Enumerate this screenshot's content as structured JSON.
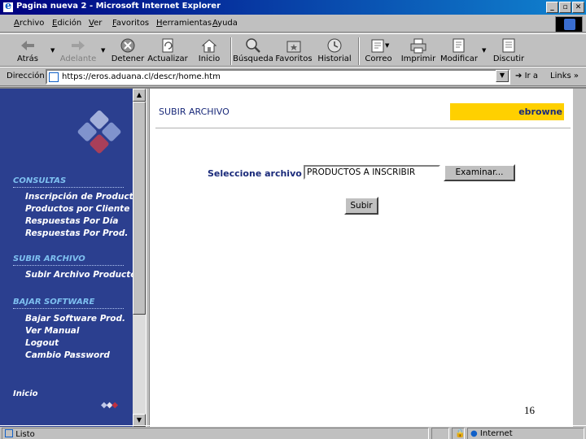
{
  "window": {
    "title": "Pagina nueva 2 - Microsoft Internet Explorer",
    "minimize": "_",
    "restore": "▫",
    "close": "✕"
  },
  "menu": [
    "Archivo",
    "Edición",
    "Ver",
    "Favoritos",
    "Herramientas",
    "Ayuda"
  ],
  "toolbar": {
    "back": "Atrás",
    "forward": "Adelante",
    "stop": "Detener",
    "refresh": "Actualizar",
    "home": "Inicio",
    "search": "Búsqueda",
    "favorites": "Favoritos",
    "history": "Historial",
    "mail": "Correo",
    "print": "Imprimir",
    "edit": "Modificar",
    "discuss": "Discutir"
  },
  "address": {
    "label": "Dirección",
    "url": "https://eros.aduana.cl/descr/home.htm",
    "go": "Ir a",
    "links": "Links"
  },
  "sidebar": {
    "consultas_heading": "CONSULTAS",
    "consultas_items": [
      "Inscripción de Producto",
      "Productos por Cliente",
      "Respuestas Por Día",
      "Respuestas Por Prod."
    ],
    "subir_heading": "SUBIR ARCHIVO",
    "subir_items": [
      "Subir Archivo Producto"
    ],
    "bajar_heading": "BAJAR SOFTWARE",
    "bajar_items": [
      "Bajar Software Prod.",
      "Ver Manual",
      "Logout",
      "Cambio Password"
    ],
    "inicio": "Inicio"
  },
  "main": {
    "section_title": "SUBIR ARCHIVO",
    "username": "ebrowne",
    "file_label": "Seleccione archivo :",
    "file_value": "PRODUCTOS A INSCRIBIR",
    "browse_button": "Examinar...",
    "submit_button": "Subir",
    "page_number": "16"
  },
  "status": {
    "text": "Listo",
    "zone": "Internet"
  },
  "colors": {
    "sidebar_bg": "#2b3f8f",
    "sidebar_heading": "#7ec0f0",
    "user_box": "#ffd000",
    "title_text": "#1a2a7a"
  }
}
